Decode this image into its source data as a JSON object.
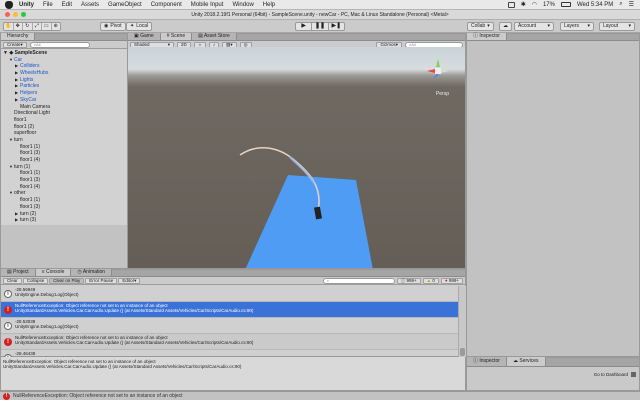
{
  "menubar": {
    "app": "Unity",
    "items": [
      "File",
      "Edit",
      "Assets",
      "GameObject",
      "Component",
      "Mobile Input",
      "Window",
      "Help"
    ],
    "battery": "17%",
    "clock": "Wed 5:34 PM"
  },
  "window": {
    "title": "Unity 2018.2.19f1 Personal (64bit) - SampleScene.unity - newCar - PC, Mac & Linux Standalone (Personal) <Metal>"
  },
  "toolbar": {
    "pivot": "Pivot",
    "local": "Local",
    "collab": "Collab",
    "account": "Account",
    "layers": "Layers",
    "layout": "Layout"
  },
  "hierarchy": {
    "tab": "Hierarchy",
    "create": "Create",
    "search_placeholder": "All",
    "scene": "SampleScene",
    "items": [
      {
        "label": "Car",
        "indent": 1,
        "arrow": "▼",
        "color": "blue"
      },
      {
        "label": "Colliders",
        "indent": 2,
        "arrow": "▶",
        "color": "blue"
      },
      {
        "label": "WheelsHubs",
        "indent": 2,
        "arrow": "▶",
        "color": "blue"
      },
      {
        "label": "Lights",
        "indent": 2,
        "arrow": "▶",
        "color": "blue"
      },
      {
        "label": "Particles",
        "indent": 2,
        "arrow": "▶",
        "color": "blue"
      },
      {
        "label": "Helpers",
        "indent": 2,
        "arrow": "▶",
        "color": "blue"
      },
      {
        "label": "SkyCar",
        "indent": 2,
        "arrow": "▶",
        "color": "blue"
      },
      {
        "label": "Main Camera",
        "indent": 2,
        "arrow": "",
        "color": "black"
      },
      {
        "label": "Directional Light",
        "indent": 1,
        "arrow": "",
        "color": "black"
      },
      {
        "label": "floor1",
        "indent": 1,
        "arrow": "",
        "color": "black"
      },
      {
        "label": "floor1 (2)",
        "indent": 1,
        "arrow": "",
        "color": "black"
      },
      {
        "label": "superfloor",
        "indent": 1,
        "arrow": "",
        "color": "black"
      },
      {
        "label": "turn",
        "indent": 1,
        "arrow": "▼",
        "color": "black"
      },
      {
        "label": "floor1 (1)",
        "indent": 2,
        "arrow": "",
        "color": "black"
      },
      {
        "label": "floor1 (3)",
        "indent": 2,
        "arrow": "",
        "color": "black"
      },
      {
        "label": "floor1 (4)",
        "indent": 2,
        "arrow": "",
        "color": "black"
      },
      {
        "label": "turn (1)",
        "indent": 1,
        "arrow": "▼",
        "color": "black"
      },
      {
        "label": "floor1 (1)",
        "indent": 2,
        "arrow": "",
        "color": "black"
      },
      {
        "label": "floor1 (3)",
        "indent": 2,
        "arrow": "",
        "color": "black"
      },
      {
        "label": "floor1 (4)",
        "indent": 2,
        "arrow": "",
        "color": "black"
      },
      {
        "label": "other",
        "indent": 1,
        "arrow": "▼",
        "color": "black"
      },
      {
        "label": "floor1 (1)",
        "indent": 2,
        "arrow": "",
        "color": "black"
      },
      {
        "label": "floor1 (3)",
        "indent": 2,
        "arrow": "",
        "color": "black"
      },
      {
        "label": "turn (2)",
        "indent": 2,
        "arrow": "▶",
        "color": "black"
      },
      {
        "label": "turn (3)",
        "indent": 2,
        "arrow": "▶",
        "color": "black"
      }
    ]
  },
  "scene_view": {
    "tabs": [
      "Game",
      "Scene",
      "Asset Store"
    ],
    "active_tab": "Scene",
    "shaded": "Shaded",
    "mode_2d": "2D",
    "gizmos": "Gizmos",
    "search_placeholder": "All",
    "persp": "Persp",
    "floor_color": "#4f9cf5"
  },
  "inspector": {
    "tab": "Inspector"
  },
  "console": {
    "tabs": [
      "Project",
      "Console",
      "Animation"
    ],
    "active_tab": "Console",
    "buttons": [
      "Clear",
      "Collapse",
      "Clear on Play",
      "Error Pause",
      "Editor"
    ],
    "counts": {
      "logs": "999+",
      "warnings": "0",
      "errors": "999+"
    },
    "rows": [
      {
        "type": "log",
        "line1": "-28.56949",
        "line2": "UnityEngine.Debug:Log(Object)"
      },
      {
        "type": "err",
        "line1": "NullReferenceException: Object reference not set to an instance of an object",
        "line2": "UnityStandardAssets.Vehicles.Car.CarAudio.Update () (at Assets/Standard Assets/Vehicles/Car/Scripts/CarAudio.cs:90)",
        "selected": true
      },
      {
        "type": "log",
        "line1": "-28.53038",
        "line2": "UnityEngine.Debug:Log(Object)"
      },
      {
        "type": "err",
        "line1": "NullReferenceException: Object reference not set to an instance of an object",
        "line2": "UnityStandardAssets.Vehicles.Car.CarAudio.Update () (at Assets/Standard Assets/Vehicles/Car/Scripts/CarAudio.cs:90)"
      },
      {
        "type": "log",
        "line1": "-28.46438",
        "line2": "UnityEngine.Debug:Log(Object)"
      }
    ],
    "detail_line1": "NullReferenceException: Object reference not set to an instance of an object",
    "detail_line2": "UnityStandardAssets.Vehicles.Car.CarAudio.Update () (at Assets/Standard Assets/Vehicles/Car/Scripts/CarAudio.cs:90)"
  },
  "bottom_right": {
    "tabs": [
      "Inspector",
      "Services"
    ],
    "active_tab": "Services",
    "dashboard_link": "Go to Dashboard"
  },
  "status_bar": {
    "message": "NullReferenceException: Object reference not set to an instance of an object"
  }
}
